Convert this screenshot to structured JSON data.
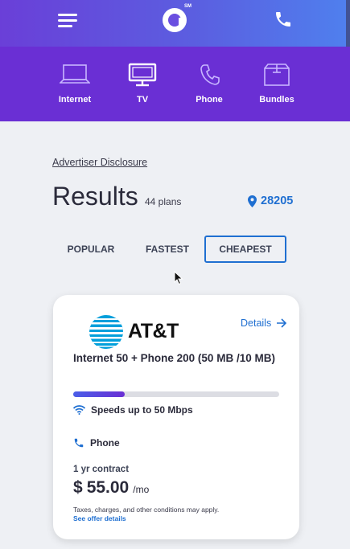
{
  "header": {
    "menu_icon": "hamburger-menu-icon",
    "logo_icon": "brand-logo-icon",
    "logo_mark": "SM",
    "phone_icon": "phone-icon"
  },
  "categories": [
    {
      "label": "Internet",
      "icon": "laptop-icon"
    },
    {
      "label": "TV",
      "icon": "tv-icon"
    },
    {
      "label": "Phone",
      "icon": "phone-icon"
    },
    {
      "label": "Bundles",
      "icon": "box-icon"
    }
  ],
  "results": {
    "disclosure": "Advertiser Disclosure",
    "title": "Results",
    "count": "44 plans",
    "zip": "28205"
  },
  "sort_tabs": [
    {
      "label": "POPULAR",
      "selected": false
    },
    {
      "label": "FASTEST",
      "selected": false
    },
    {
      "label": "CHEAPEST",
      "selected": true
    }
  ],
  "plan": {
    "provider": "AT&T",
    "details_label": "Details",
    "name": "Internet 50 + Phone 200 (50 MB /10 MB)",
    "speed_fraction": 0.25,
    "speed_text": "Speeds up to 50 Mbps",
    "phone_text": "Phone",
    "contract": "1 yr contract",
    "currency": "$",
    "price": "55.00",
    "per": "/mo",
    "disclaimer": "Taxes, charges, and other conditions may apply.",
    "offer_link": "See offer details"
  },
  "colors": {
    "accent": "#1f6fd1",
    "nav_purple": "#6a2fd4",
    "page_bg": "#eef0f4"
  }
}
